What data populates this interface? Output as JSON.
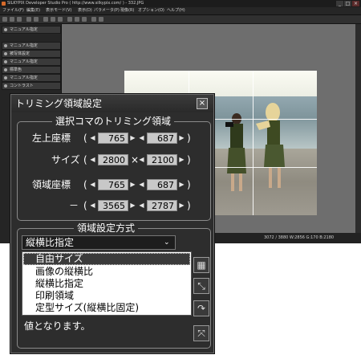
{
  "app": {
    "title": "SILKYPIX Developer Studio Pro ( http://www.silkypix.com/ ) - 332.JPG",
    "menu": [
      "ファイル(F)",
      "編集(E)",
      "表示モード(V)",
      "表示(D)",
      "パラメータ(P)",
      "現像(R)",
      "オプション(O)",
      "ヘルプ(H)"
    ],
    "panels": [
      "マニュアル指定",
      "マニュアル指定",
      "被写体設定",
      "マニュアル指定",
      "標準色",
      "マニュアル指定",
      "コントラスト"
    ],
    "status": "3072 / 3880 W:2856 G:170 B:2180"
  },
  "dialog": {
    "title": "トリミング領域設定",
    "close_label": "×",
    "group1_title": "選択コマのトリミング領域",
    "rows": {
      "top_left_label": "左上座標",
      "top_left_x": "765",
      "top_left_y": "687",
      "size_label": "サイズ",
      "size_w": "2800",
      "size_h": "2100",
      "area_label": "領域座標",
      "area_x1": "765",
      "area_y1": "687",
      "area_x2": "3565",
      "area_y2": "2787",
      "dash": "－",
      "times": "×"
    },
    "paren_open": "(",
    "paren_close": ")",
    "arrow_left": "◀",
    "arrow_right": "▶",
    "group2_title": "領域設定方式",
    "method_selected": "縦横比指定",
    "dropdown_arrow": "⌄",
    "dropdown_options": [
      "自由サイズ",
      "画像の縦横比",
      "縦横比指定",
      "印刷領域",
      "定型サイズ(縦横比固定)"
    ],
    "description_tail": "値となります。"
  }
}
